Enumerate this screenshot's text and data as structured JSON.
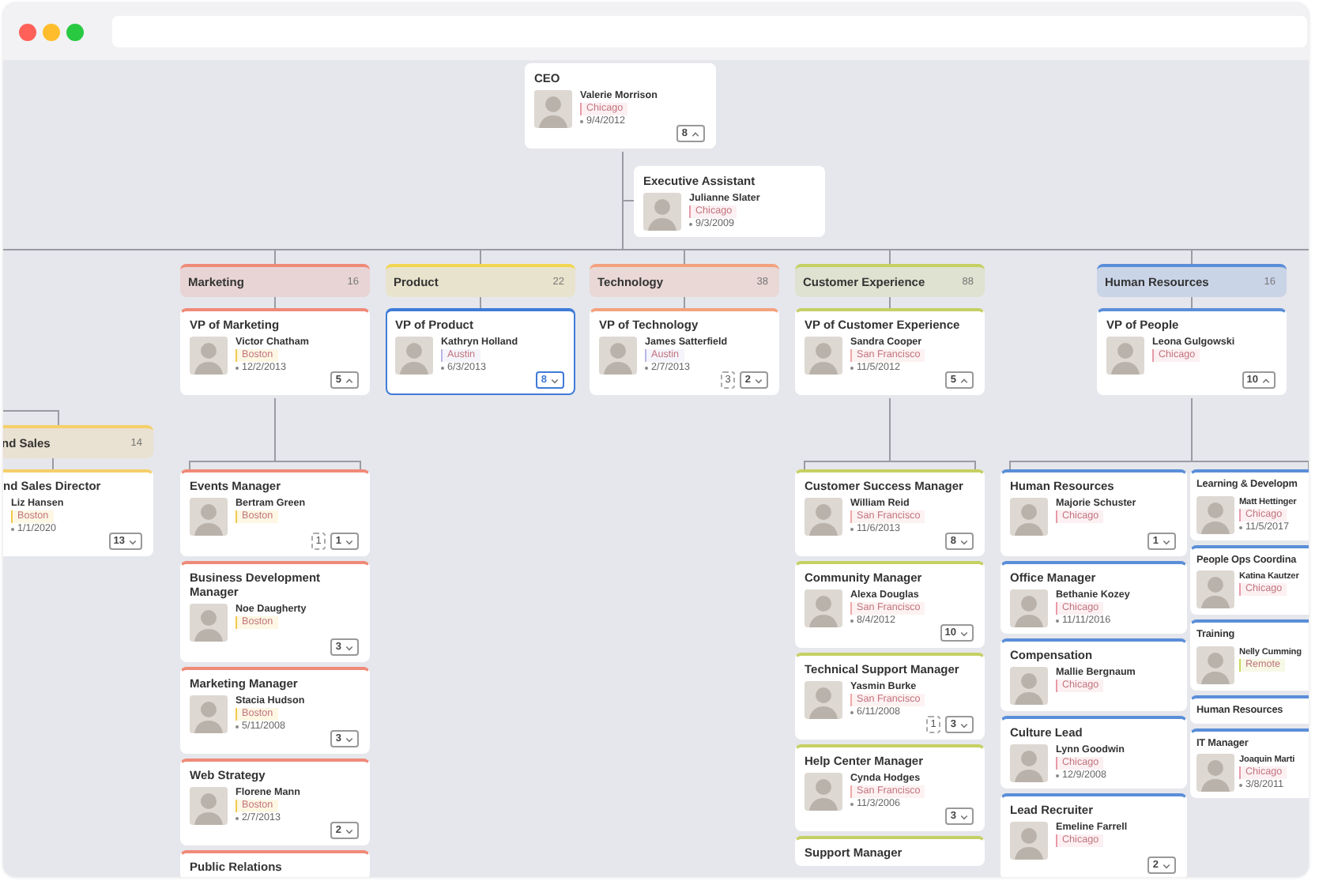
{
  "ceo": {
    "title": "CEO",
    "name": "Valerie Morrison",
    "location": "Chicago",
    "color": "#e89aa6",
    "date": "9/4/2012",
    "reports": "8",
    "expanded": true,
    "selected": false
  },
  "assistant": {
    "title": "Executive Assistant",
    "name": "Julianne Slater",
    "location": "Chicago",
    "color": "#e89aa6",
    "date": "9/3/2009",
    "selected": false
  },
  "departments": [
    {
      "name": "nd Sales",
      "count": "14",
      "color": "#f5cf6b",
      "children": [
        {
          "title": "nd Sales Director",
          "name": "Liz Hansen",
          "location": "Boston",
          "color": "#f2c94c",
          "date": "1/1/2020",
          "reports": "13",
          "expanded": false,
          "selected": false
        }
      ]
    },
    {
      "name": "Marketing",
      "count": "16",
      "color": "#ef8a78",
      "vp": {
        "title": "VP of Marketing",
        "name": "Victor Chatham",
        "location": "Boston",
        "color": "#f2c94c",
        "date": "12/2/2013",
        "reports": "5",
        "expanded": true,
        "selected": false
      },
      "children": [
        {
          "title": "Events Manager",
          "name": "Bertram Green",
          "location": "Boston",
          "color": "#f2c94c",
          "extra": "1",
          "reports": "1",
          "expanded": false,
          "selected": false
        },
        {
          "title": "Business Development Manager",
          "name": "Noe Daugherty",
          "location": "Boston",
          "color": "#f2c94c",
          "reports": "3",
          "expanded": false,
          "selected": false
        },
        {
          "title": "Marketing Manager",
          "name": "Stacia Hudson",
          "location": "Boston",
          "color": "#f2c94c",
          "date": "5/11/2008",
          "reports": "3",
          "expanded": false,
          "selected": false
        },
        {
          "title": "Web Strategy",
          "name": "Florene Mann",
          "location": "Boston",
          "color": "#f2c94c",
          "date": "2/7/2013",
          "reports": "2",
          "expanded": false,
          "selected": false
        },
        {
          "title": "Public Relations",
          "selected": false
        }
      ]
    },
    {
      "name": "Product",
      "count": "22",
      "color": "#f2d54e",
      "vp": {
        "title": "VP of Product",
        "name": "Kathryn Holland",
        "location": "Austin",
        "color": "#b9b6e6",
        "date": "6/3/2013",
        "reports": "8",
        "expanded": false,
        "selected": true
      }
    },
    {
      "name": "Technology",
      "count": "38",
      "color": "#f3a27e",
      "vp": {
        "title": "VP of Technology",
        "name": "James Satterfield",
        "location": "Austin",
        "color": "#b9b6e6",
        "date": "2/7/2013",
        "extra": "3",
        "reports": "2",
        "expanded": false,
        "selected": false
      }
    },
    {
      "name": "Customer Experience",
      "count": "88",
      "color": "#c5d063",
      "vp": {
        "title": "VP of Customer Experience",
        "name": "Sandra Cooper",
        "location": "San Francisco",
        "color": "#f0a8a8",
        "date": "11/5/2012",
        "reports": "5",
        "expanded": true,
        "selected": false
      },
      "children": [
        {
          "title": "Customer Success Manager",
          "name": "William Reid",
          "location": "San Francisco",
          "color": "#f0a8a8",
          "date": "11/6/2013",
          "reports": "8",
          "expanded": false,
          "selected": false
        },
        {
          "title": "Community Manager",
          "name": "Alexa Douglas",
          "location": "San Francisco",
          "color": "#f0a8a8",
          "date": "8/4/2012",
          "reports": "10",
          "expanded": false,
          "selected": false
        },
        {
          "title": "Technical Support Manager",
          "name": "Yasmin Burke",
          "location": "San Francisco",
          "color": "#f0a8a8",
          "date": "6/11/2008",
          "extra": "1",
          "reports": "3",
          "expanded": false,
          "selected": false
        },
        {
          "title": "Help Center Manager",
          "name": "Cynda Hodges",
          "location": "San Francisco",
          "color": "#f0a8a8",
          "date": "11/3/2006",
          "reports": "3",
          "expanded": false,
          "selected": false
        },
        {
          "title": "Support Manager",
          "selected": false
        }
      ]
    },
    {
      "name": "Human Resources",
      "count": "16",
      "color": "#5a8ed8",
      "vp": {
        "title": "VP of People",
        "name": "Leona Gulgowski",
        "location": "Chicago",
        "color": "#e89aa6",
        "reports": "10",
        "expanded": true,
        "selected": false
      },
      "children": [
        {
          "title": "Human Resources",
          "name": "Majorie Schuster",
          "location": "Chicago",
          "color": "#e89aa6",
          "reports": "1",
          "expanded": false,
          "selected": false
        },
        {
          "title": "Office Manager",
          "name": "Bethanie Kozey",
          "location": "Chicago",
          "color": "#e89aa6",
          "date": "11/11/2016",
          "selected": false
        },
        {
          "title": "Compensation",
          "name": "Mallie Bergnaum",
          "location": "Chicago",
          "color": "#e89aa6",
          "selected": false
        },
        {
          "title": "Culture Lead",
          "name": "Lynn Goodwin",
          "location": "Chicago",
          "color": "#e89aa6",
          "date": "12/9/2008",
          "selected": false
        },
        {
          "title": "Lead Recruiter",
          "name": "Emeline Farrell",
          "location": "Chicago",
          "color": "#e89aa6",
          "reports": "2",
          "expanded": false,
          "selected": false
        },
        {
          "title": "Learning & Developm",
          "name": "Matt Hettinger",
          "location": "Chicago",
          "color": "#e89aa6",
          "date": "11/5/2017",
          "selected": false
        },
        {
          "title": "People Ops Coordina",
          "name": "Katina Kautzer",
          "location": "Chicago",
          "color": "#e89aa6",
          "selected": false
        },
        {
          "title": "Training",
          "name": "Nelly Cumming",
          "location": "Remote",
          "color": "#c9d85a",
          "selected": false
        },
        {
          "title": "Human Resources",
          "selected": false
        },
        {
          "title": "IT Manager",
          "name": "Joaquin Marti",
          "location": "Chicago",
          "color": "#e89aa6",
          "date": "3/8/2011",
          "selected": false
        }
      ]
    }
  ]
}
